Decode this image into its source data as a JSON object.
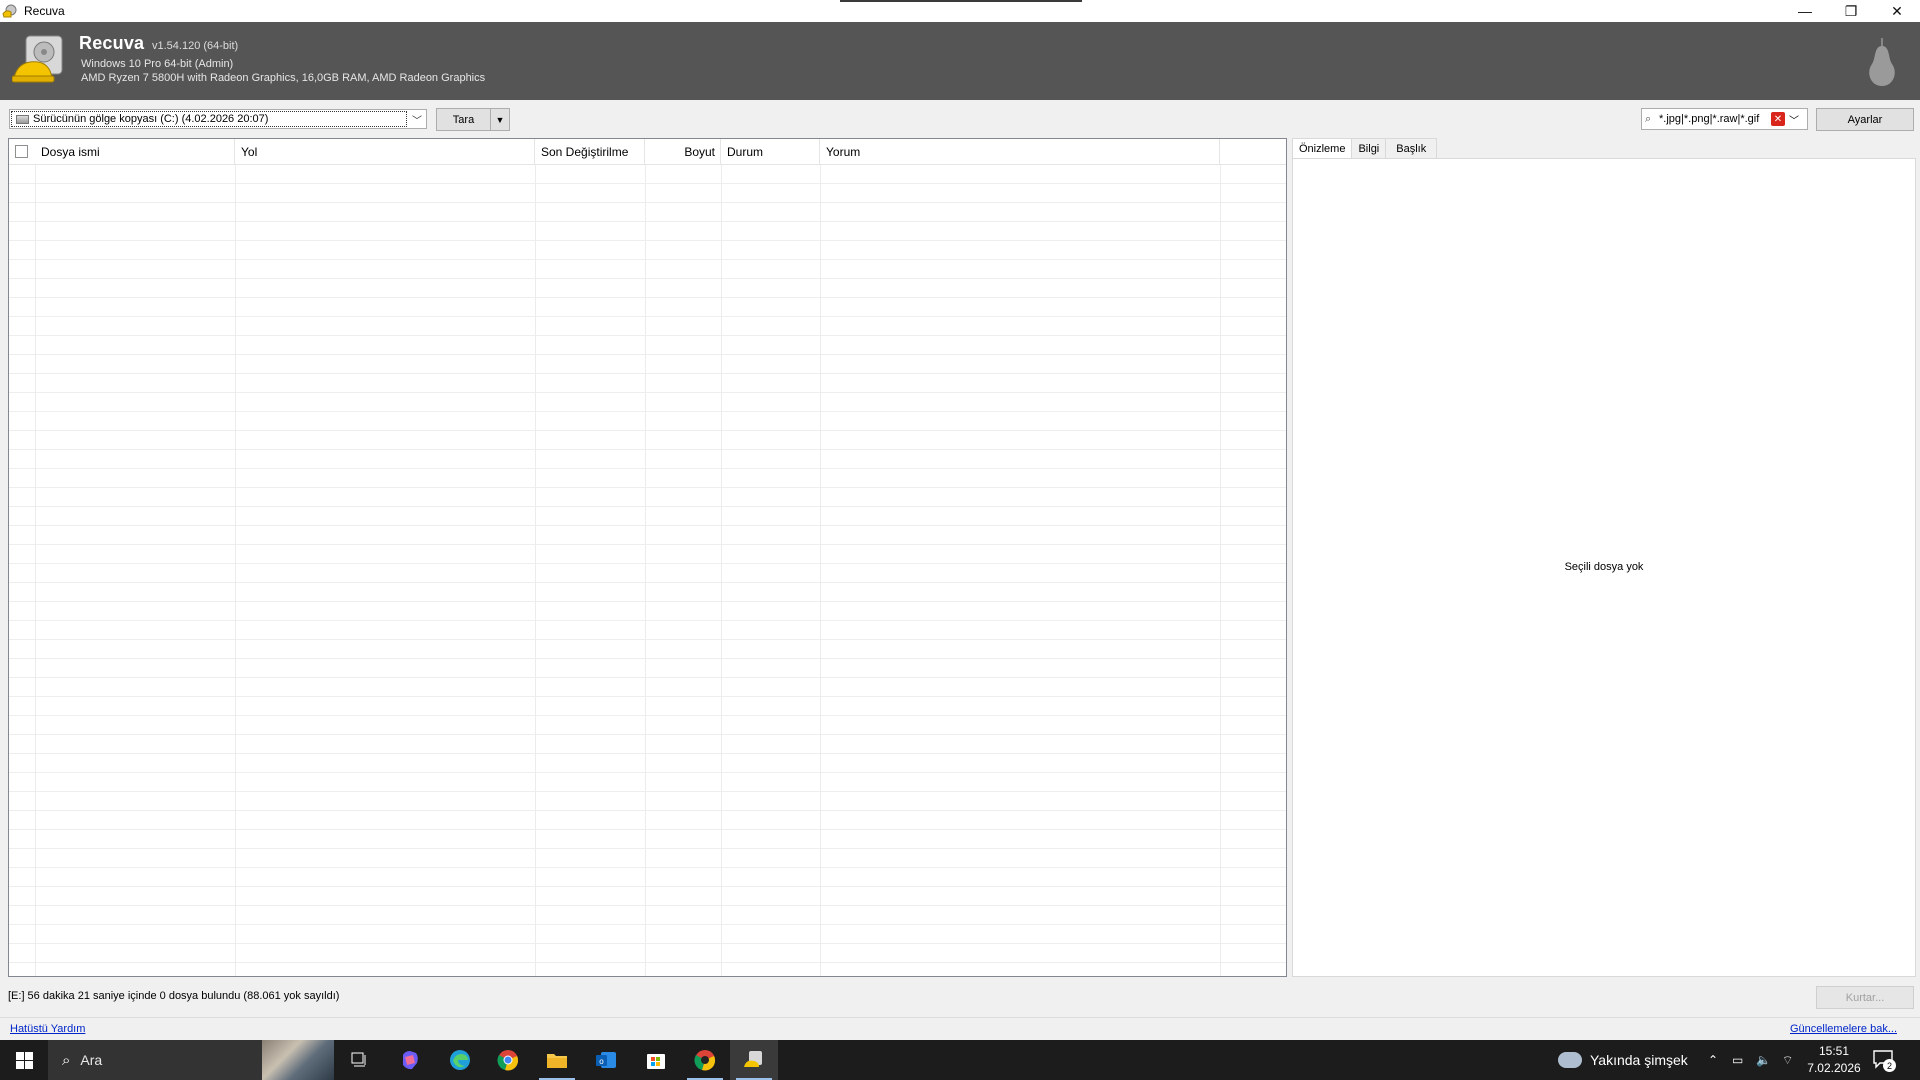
{
  "window": {
    "title": "Recuva",
    "minimize": "—",
    "restore": "❐",
    "close": "✕"
  },
  "header": {
    "app_name": "Recuva",
    "version": "v1.54.120 (64-bit)",
    "os_line": "Windows 10 Pro 64-bit (Admin)",
    "hw_line": "AMD Ryzen 7 5800H with Radeon Graphics, 16,0GB RAM, AMD Radeon Graphics"
  },
  "toolbar": {
    "drive_selected": "Sürücünün gölge kopyası (C:) (4.02.2026 20:07)",
    "scan_label": "Tara",
    "filter_value": "*.jpg|*.png|*.raw|*.gif",
    "settings_label": "Ayarlar"
  },
  "file_list": {
    "columns": [
      "Dosya ismi",
      "Yol",
      "Son Değiştirilme",
      "Boyut",
      "Durum",
      "Yorum"
    ],
    "rows": []
  },
  "preview": {
    "tabs": [
      "Önizleme",
      "Bilgi",
      "Başlık"
    ],
    "active_tab": "Önizleme",
    "empty_message": "Seçili dosya yok"
  },
  "status": {
    "text": "[E:] 56 dakika 21 saniye içinde 0 dosya bulundu (88.061 yok sayıldı)",
    "recover_label": "Kurtar..."
  },
  "footer": {
    "help_link": "Hatüstü Yardım",
    "update_link": "Güncellemelere bak..."
  },
  "taskbar": {
    "search_placeholder": "Ara",
    "weather": "Yakında şimşek",
    "time": "15:51",
    "date": "7.02.2026",
    "notification_count": "2"
  },
  "colors": {
    "header_bg": "#555555",
    "link": "#0026c9",
    "taskbar_bg": "#1c1c1c"
  }
}
